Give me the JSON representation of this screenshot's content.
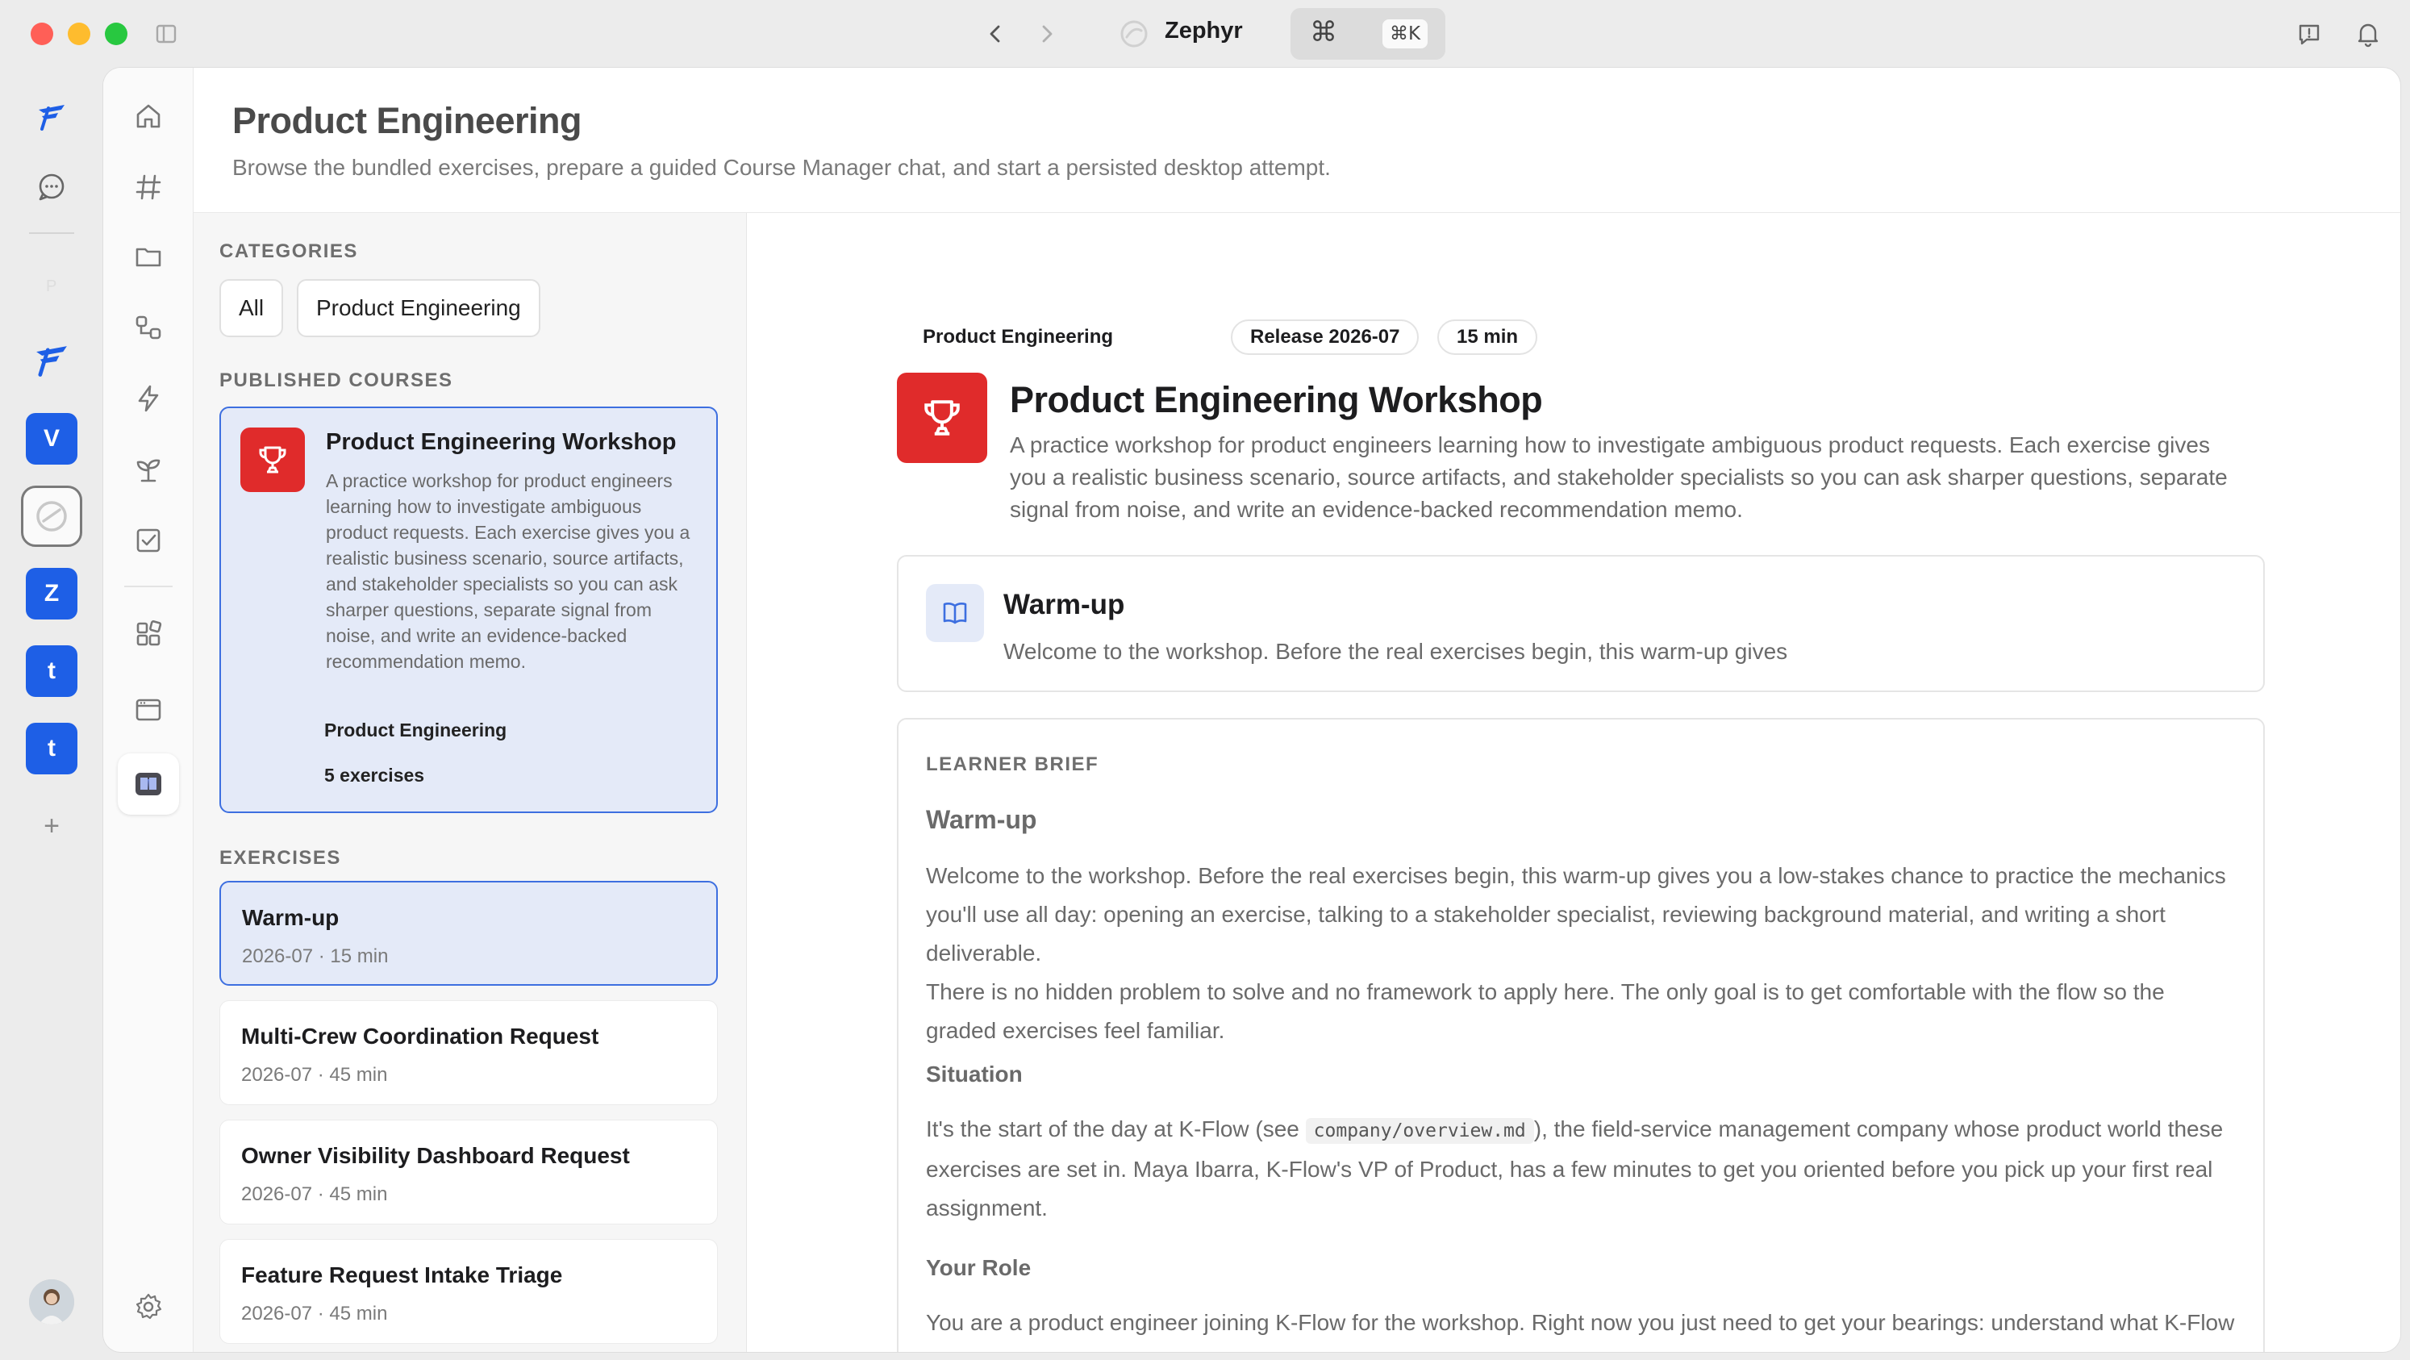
{
  "app": {
    "title": "Zephyr",
    "search_shortcut": "⌘K",
    "search_glyph": "⌘"
  },
  "rail": {
    "workspaces": [
      {
        "letter": "V",
        "color": "#1e5fe6"
      },
      {
        "letter": "Z",
        "color": "#1e5fe6"
      },
      {
        "letter": "t",
        "color": "#1e5fe6"
      },
      {
        "letter": "t",
        "color": "#1e5fe6"
      }
    ],
    "add_label": "+"
  },
  "page": {
    "title": "Product Engineering",
    "subtitle": "Browse the bundled exercises, prepare a guided Course Manager chat, and start a persisted desktop attempt."
  },
  "left": {
    "categories_label": "CATEGORIES",
    "categories": [
      "All",
      "Product Engineering"
    ],
    "published_label": "PUBLISHED COURSES",
    "course": {
      "name": "Product Engineering Workshop",
      "description": "A practice workshop for product engineers learning how to investigate ambiguous product requests. Each exercise gives you a realistic business scenario, source artifacts, and stakeholder specialists so you can ask sharper questions, separate signal from noise, and write an evidence-backed recommendation memo.",
      "tag_category": "Product Engineering",
      "tag_count": "5 exercises"
    },
    "exercises_label": "EXERCISES",
    "exercises": [
      {
        "title": "Warm-up",
        "meta": "2026-07 · 15 min"
      },
      {
        "title": "Multi-Crew Coordination Request",
        "meta": "2026-07 · 45 min"
      },
      {
        "title": "Owner Visibility Dashboard Request",
        "meta": "2026-07 · 45 min"
      },
      {
        "title": "Feature Request Intake Triage",
        "meta": "2026-07 · 45 min"
      }
    ]
  },
  "detail": {
    "badges": [
      "Product Engineering",
      "Release 2026-07",
      "15 min"
    ],
    "title": "Product Engineering Workshop",
    "description": "A practice workshop for product engineers learning how to investigate ambiguous product requests. Each exercise gives you a realistic business scenario, source artifacts, and stakeholder specialists so you can ask sharper questions, separate signal from noise, and write an evidence-backed recommendation memo.",
    "warmup": {
      "title": "Warm-up",
      "preview": "Welcome to the workshop. Before the real exercises begin, this warm-up gives"
    },
    "brief": {
      "label": "LEARNER BRIEF",
      "heading": "Warm-up",
      "intro_p1": "Welcome to the workshop. Before the real exercises begin, this warm-up gives you a low-stakes chance to practice the mechanics you'll use all day: opening an exercise, talking to a stakeholder specialist, reviewing background material, and writing a short deliverable.",
      "intro_p2": "There is no hidden problem to solve and no framework to apply here. The only goal is to get comfortable with the flow so the graded exercises feel familiar.",
      "situation_label": "Situation",
      "situation_before": "It's the start of the day at K-Flow (see ",
      "situation_code": "company/overview.md",
      "situation_after": "), the field-service management company whose product world these exercises are set in. Maya Ibarra, K-Flow's VP of Product, has a few minutes to get you oriented before you pick up your first real assignment.",
      "role_label": "Your Role",
      "role_text": "You are a product engineer joining K-Flow for the workshop. Right now you just need to get your bearings: understand what K-Flow does, who you'll be talking to, and how the working environment behaves."
    }
  },
  "colors": {
    "accent": "#3d6fe0",
    "selected_bg": "#e4eaf8",
    "trophy_red": "#e02b2b"
  }
}
